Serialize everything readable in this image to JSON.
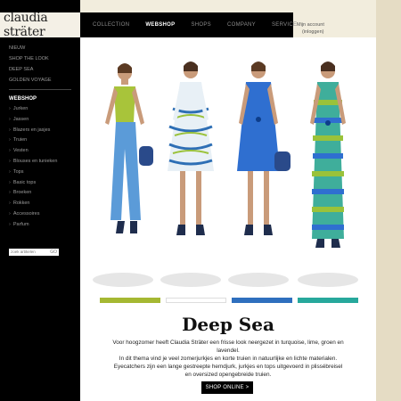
{
  "brand": {
    "logo_text": "claudia sträter"
  },
  "topnav": [
    {
      "label": "COLLECTION",
      "active": false
    },
    {
      "label": "WEBSHOP",
      "active": true
    },
    {
      "label": "SHOPS",
      "active": false
    },
    {
      "label": "COMPANY",
      "active": false
    },
    {
      "label": "SERVICE",
      "active": false
    }
  ],
  "account": {
    "my_account": "Mijn account",
    "login": "(inloggen)"
  },
  "sidebar": {
    "top_items": [
      "NIEUW",
      "SHOP THE LOOK",
      "DEEP SEA",
      "GOLDEN VOYAGE"
    ],
    "heading": "WEBSHOP",
    "sub_items": [
      "Jurken",
      "Jassen",
      "Blazers en jasjes",
      "Truien",
      "Vesten",
      "Blouses en tunieken",
      "Tops",
      "Basic tops",
      "Broeken",
      "Rokken",
      "Accessoires",
      "Parfum"
    ],
    "search_placeholder": "zoek artikelen",
    "search_icon": "search-go-icon",
    "search_glyph": "GO"
  },
  "hero": {
    "stripe_colors": [
      "#a5b832",
      "#ffffff",
      "#2f6fbe",
      "#27a89c"
    ]
  },
  "main": {
    "title": "Deep Sea",
    "body_lines": [
      "Voor hoogzomer heeft Claudia Sträter een frisse look neergezet in turquoise, lime, groen en lavendel.",
      "In dit thema vind je veel zomerjurkjes en korte truien in natuurlijke en lichte materialen.",
      "Eyecatchers zijn een lange gestreepte hemdjurk, jurkjes en tops uitgevoerd in plissébreisel",
      "en oversized opengebreide truien."
    ],
    "cta_label": "SHOP ONLINE  >"
  }
}
